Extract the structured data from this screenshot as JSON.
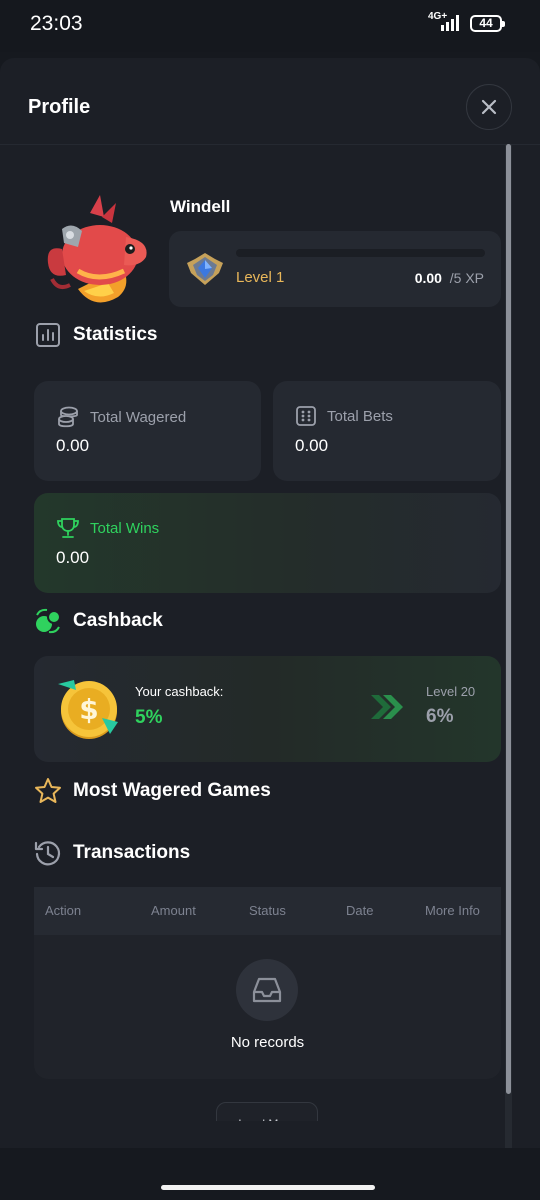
{
  "status_bar": {
    "time": "23:03",
    "network": "4G+",
    "battery": "44"
  },
  "header": {
    "title": "Profile",
    "close_icon": "close-icon"
  },
  "profile": {
    "username": "Windell",
    "level_label": "Level 1",
    "xp_current": "0.00",
    "xp_max": "5 XP",
    "xp_progress": 0,
    "level_badge_icon": "rank-badge-icon"
  },
  "statistics": {
    "title": "Statistics",
    "cards": [
      {
        "label": "Total Wagered",
        "value": "0.00",
        "icon": "coins-stack-icon"
      },
      {
        "label": "Total Bets",
        "value": "0.00",
        "icon": "dice-icon"
      },
      {
        "label": "Total Wins",
        "value": "0.00",
        "icon": "trophy-icon"
      }
    ]
  },
  "cashback": {
    "title": "Cashback",
    "label": "Your cashback:",
    "value": "5%",
    "next_level_label": "Level 20",
    "next_value": "6%"
  },
  "most_wagered": {
    "title": "Most Wagered Games"
  },
  "transactions": {
    "title": "Transactions",
    "columns": [
      "Action",
      "Amount",
      "Status",
      "Date",
      "More Info"
    ],
    "empty_text": "No records",
    "load_more_label": "Load More"
  },
  "colors": {
    "accent_green": "#2fd25e",
    "gold": "#e9b75a",
    "background": "#1c1f26",
    "card": "#252931"
  }
}
